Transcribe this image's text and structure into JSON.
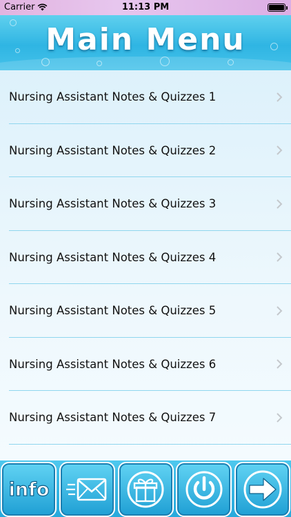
{
  "status_bar": {
    "carrier": "Carrier",
    "time": "11:13 PM"
  },
  "header": {
    "title": "Main Menu"
  },
  "menu": {
    "items": [
      {
        "label": "Nursing Assistant Notes & Quizzes 1"
      },
      {
        "label": "Nursing Assistant Notes & Quizzes 2"
      },
      {
        "label": "Nursing Assistant Notes & Quizzes 3"
      },
      {
        "label": "Nursing Assistant Notes & Quizzes 4"
      },
      {
        "label": "Nursing Assistant Notes & Quizzes 5"
      },
      {
        "label": "Nursing Assistant Notes & Quizzes 6"
      },
      {
        "label": "Nursing Assistant Notes & Quizzes 7"
      }
    ]
  },
  "toolbar": {
    "info_label": "info",
    "buttons": [
      "info-icon",
      "mail-icon",
      "gift-icon",
      "power-icon",
      "arrow-right-icon"
    ]
  },
  "colors": {
    "header_blue": "#2fb5e3",
    "status_bar_pink": "#e2b4e0",
    "divider": "#8fd6ee",
    "list_bg": "#ddf1fb"
  }
}
